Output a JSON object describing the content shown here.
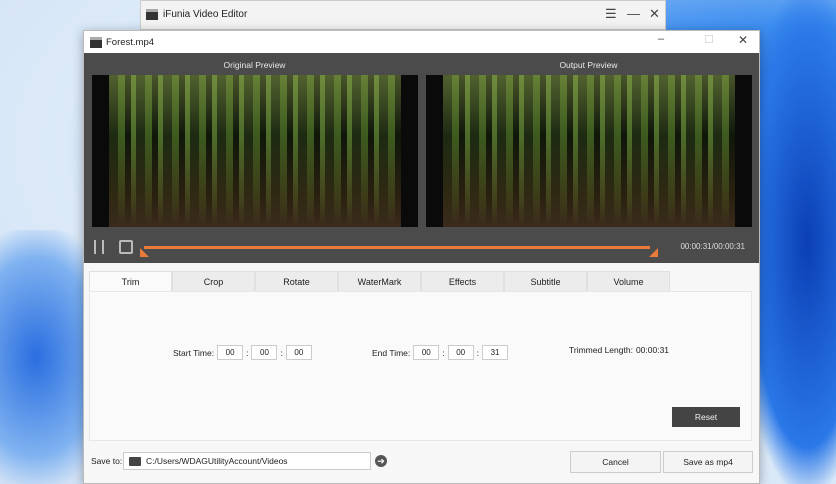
{
  "back_window": {
    "title": "iFunia Video Editor"
  },
  "window": {
    "title": "Forest.mp4"
  },
  "preview": {
    "original_label": "Original Preview",
    "output_label": "Output Preview",
    "time": "00:00:31/00:00:31",
    "progress": 1.0
  },
  "tabs": [
    {
      "label": "Trim"
    },
    {
      "label": "Crop"
    },
    {
      "label": "Rotate"
    },
    {
      "label": "WaterMark"
    },
    {
      "label": "Effects"
    },
    {
      "label": "Subtitle"
    },
    {
      "label": "Volume"
    }
  ],
  "trim": {
    "start_label": "Start Time:",
    "start": [
      "00",
      "00",
      "00"
    ],
    "end_label": "End Time:",
    "end": [
      "00",
      "00",
      "31"
    ],
    "sep": ":",
    "length_label": "Trimmed Length:",
    "length": "00:00:31",
    "reset": "Reset"
  },
  "footer": {
    "save_to_label": "Save to:",
    "path": "C:/Users/WDAGUtilityAccount/Videos",
    "cancel": "Cancel",
    "save": "Save as mp4"
  }
}
